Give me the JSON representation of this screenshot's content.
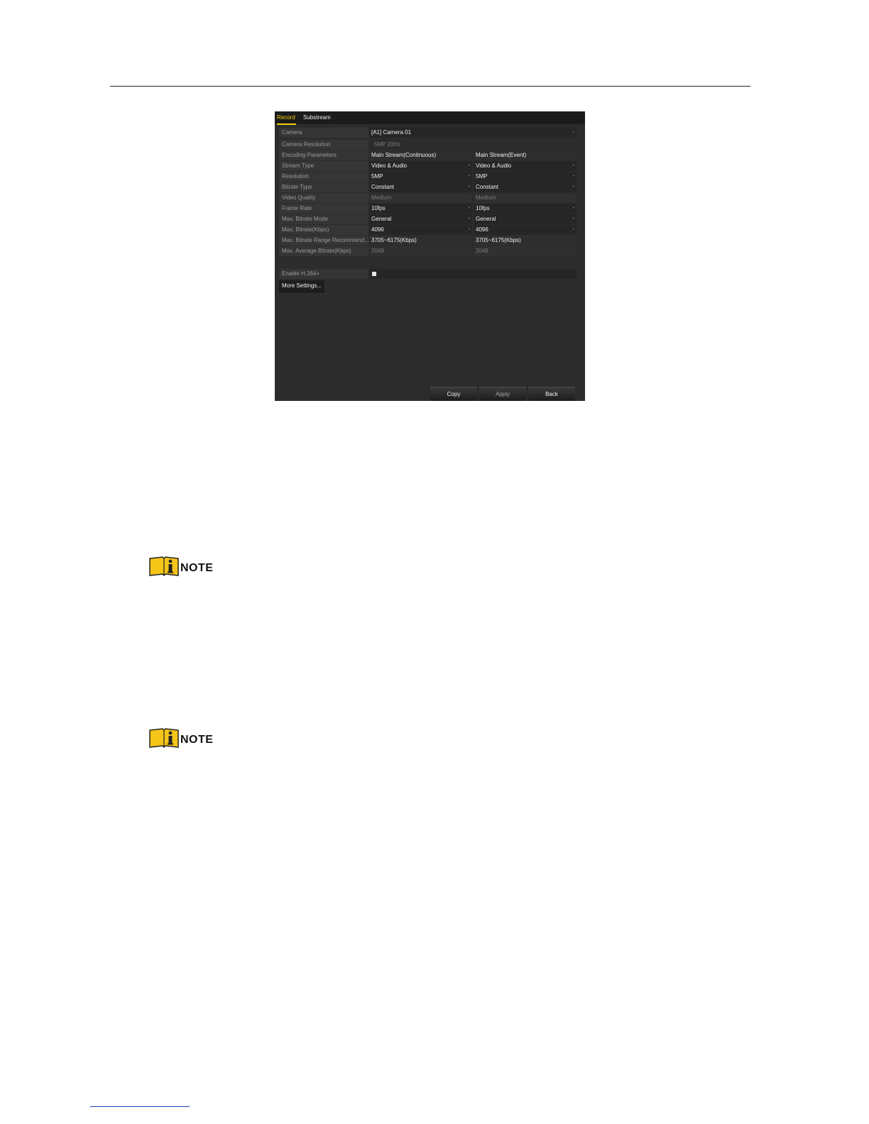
{
  "tabs": [
    "Record",
    "Substream"
  ],
  "camera": {
    "label": "Camera",
    "value": "[A1] Camera 01"
  },
  "camera_resolution": {
    "label": "Camera Resolution",
    "value": "5MP 20Hz"
  },
  "encoding": {
    "label": "Encoding Parameters",
    "col1": "Main Stream(Continuous)",
    "col2": "Main Stream(Event)"
  },
  "rows": {
    "stream_type": {
      "label": "Stream Type",
      "v1": "Video & Audio",
      "v2": "Video & Audio"
    },
    "resolution": {
      "label": "Resolution",
      "v1": "5MP",
      "v2": "5MP"
    },
    "bitrate_type": {
      "label": "Bitrate Type",
      "v1": "Constant",
      "v2": "Constant"
    },
    "video_quality": {
      "label": "Video Quality",
      "v1": "Medium",
      "v2": "Medium"
    },
    "frame_rate": {
      "label": "Frame Rate",
      "v1": "10fps",
      "v2": "10fps"
    },
    "max_bitrate_mode": {
      "label": "Max. Bitrate Mode",
      "v1": "General",
      "v2": "General"
    },
    "max_bitrate": {
      "label": "Max. Bitrate(Kbps)",
      "v1": "4096",
      "v2": "4096"
    },
    "bitrate_range": {
      "label": "Max. Bitrate Range Recommend...",
      "v1": "3705~6175(Kbps)",
      "v2": "3705~6175(Kbps)"
    },
    "avg_bitrate": {
      "label": "Max. Average Bitrate(Kbps)",
      "v1": "2048",
      "v2": "2048"
    }
  },
  "h264": {
    "label": "Enable H.264+",
    "checked": true
  },
  "buttons": {
    "more": "More Settings...",
    "copy": "Copy",
    "apply": "Apply",
    "back": "Back"
  },
  "dropdown_glyph": "-",
  "notes": [
    "NOTE",
    "NOTE"
  ],
  "colors": {
    "accent": "#f0d000",
    "note_icon": "#f5c518"
  }
}
